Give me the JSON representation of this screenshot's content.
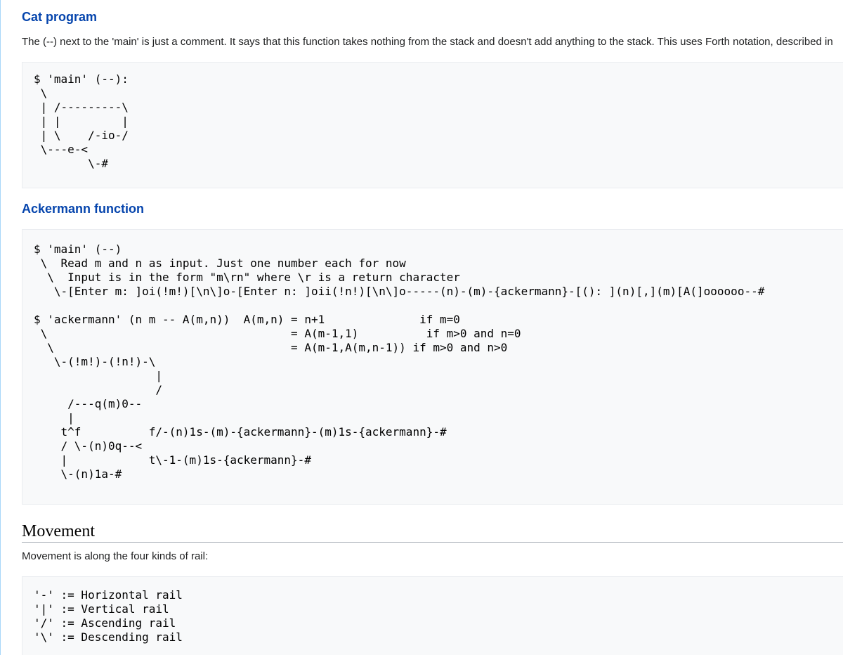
{
  "sections": {
    "cat": {
      "heading": "Cat program",
      "paragraph": "The (--) next to the 'main' is just a comment. It says that this function takes nothing from the stack and doesn't add anything to the stack. This uses Forth notation, described in",
      "code": "$ 'main' (--):\n \\\n | /---------\\\n | |         |\n | \\    /-io-/\n \\---e-<\n        \\-#"
    },
    "ackermann": {
      "heading": "Ackermann function",
      "code_main": "$ 'main' (--)\n \\  Read m and n as input. Just one number each for now\n  \\  Input is in the form \"m\\rn\" where \\r is a return character\n   \\-[Enter m: ]oi(!m!)[\\n\\]o-[Enter n: ]oii(!n!)[\\n\\]o-----(n)-(m)-{ackermann}-[(): ](n)[,](m)[A(]oooooo--#",
      "code_ackermann": "$ 'ackermann' (n m -- A(m,n))  A(m,n) = n+1              if m=0\n \\                                    = A(m-1,1)          if m>0 and n=0\n  \\                                   = A(m-1,A(m,n-1)) if m>0 and n>0\n   \\-(!m!)-(!n!)-\\\n                  |\n                  /\n     /---q(m)0--\n     |\n    t^f          f/-(n)1s-(m)-{ackermann}-(m)1s-{ackermann}-#\n    / \\-(n)0q--<\n    |            t\\-1-(m)1s-{ackermann}-#\n    \\-(n)1a-#"
    },
    "movement": {
      "heading": "Movement",
      "paragraph": "Movement is along the four kinds of rail:",
      "code": "'-' := Horizontal rail\n'|' := Vertical rail\n'/' := Ascending rail\n'\\' := Descending rail"
    }
  }
}
